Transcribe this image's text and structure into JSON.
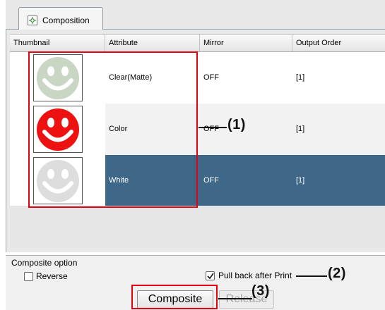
{
  "tab": {
    "label": "Composition",
    "icon": "composition-tab-icon"
  },
  "table": {
    "columns": [
      "Thumbnail",
      "Attribute",
      "Mirror",
      "Output Order"
    ],
    "rows": [
      {
        "thumb_color": "#c9d6c4",
        "attribute": "Clear(Matte)",
        "mirror": "OFF",
        "order": "[1]"
      },
      {
        "thumb_color": "#ee1111",
        "attribute": "Color",
        "mirror": "OFF",
        "order": "[1]"
      },
      {
        "thumb_color": "#dddddd",
        "attribute": "White",
        "mirror": "OFF",
        "order": "[1]",
        "selected": true
      }
    ]
  },
  "options": {
    "title": "Composite option",
    "reverse": {
      "label": "Reverse",
      "checked": false
    },
    "pull_back": {
      "label": "Pull back after Print",
      "checked": true
    }
  },
  "buttons": {
    "composite": "Composite",
    "release": "Release"
  },
  "annotations": [
    "(1)",
    "(2)",
    "(3)"
  ],
  "colors": {
    "highlight": "#3f6888",
    "callout_box": "#e60012"
  }
}
